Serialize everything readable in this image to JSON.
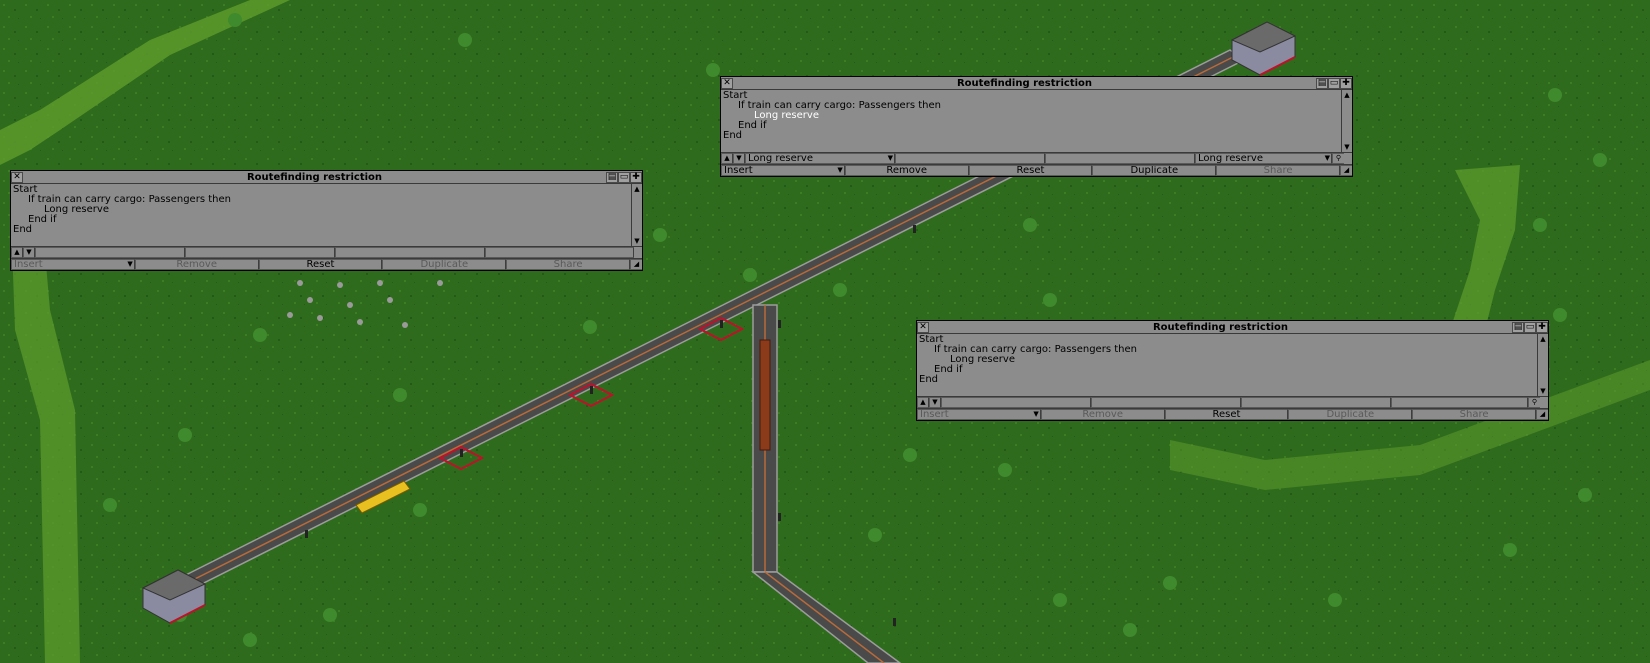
{
  "windows": [
    {
      "title": "Routefinding restriction",
      "lines": [
        "Start",
        "If train can carry cargo: Passengers then",
        "Long reserve",
        "End if",
        "End"
      ],
      "row1_left": "",
      "row1_right": "",
      "buttons": [
        "Insert",
        "Remove",
        "Reset",
        "Duplicate",
        "Share"
      ]
    },
    {
      "title": "Routefinding restriction",
      "lines": [
        "Start",
        "If train can carry cargo: Passengers then",
        "Long reserve",
        "End if",
        "End"
      ],
      "row1_left": "Long reserve",
      "row1_right": "Long reserve",
      "buttons": [
        "Insert",
        "Remove",
        "Reset",
        "Duplicate",
        "Share"
      ]
    },
    {
      "title": "Routefinding restriction",
      "lines": [
        "Start",
        "If train can carry cargo: Passengers then",
        "Long reserve",
        "End if",
        "End"
      ],
      "row1_left": "",
      "row1_right": "",
      "buttons": [
        "Insert",
        "Remove",
        "Reset",
        "Duplicate",
        "Share"
      ]
    }
  ],
  "icons": {
    "close": "close-icon",
    "debug": "debug-icon",
    "shade": "shade-icon",
    "sticky": "pin-icon",
    "resize": "resize-icon"
  },
  "colors": {
    "grass": "#2f6b1c",
    "window": "#8c8c8c",
    "selected_text": "#ffffff",
    "signal_highlight": "#c0102a",
    "train": "#e8c020"
  }
}
